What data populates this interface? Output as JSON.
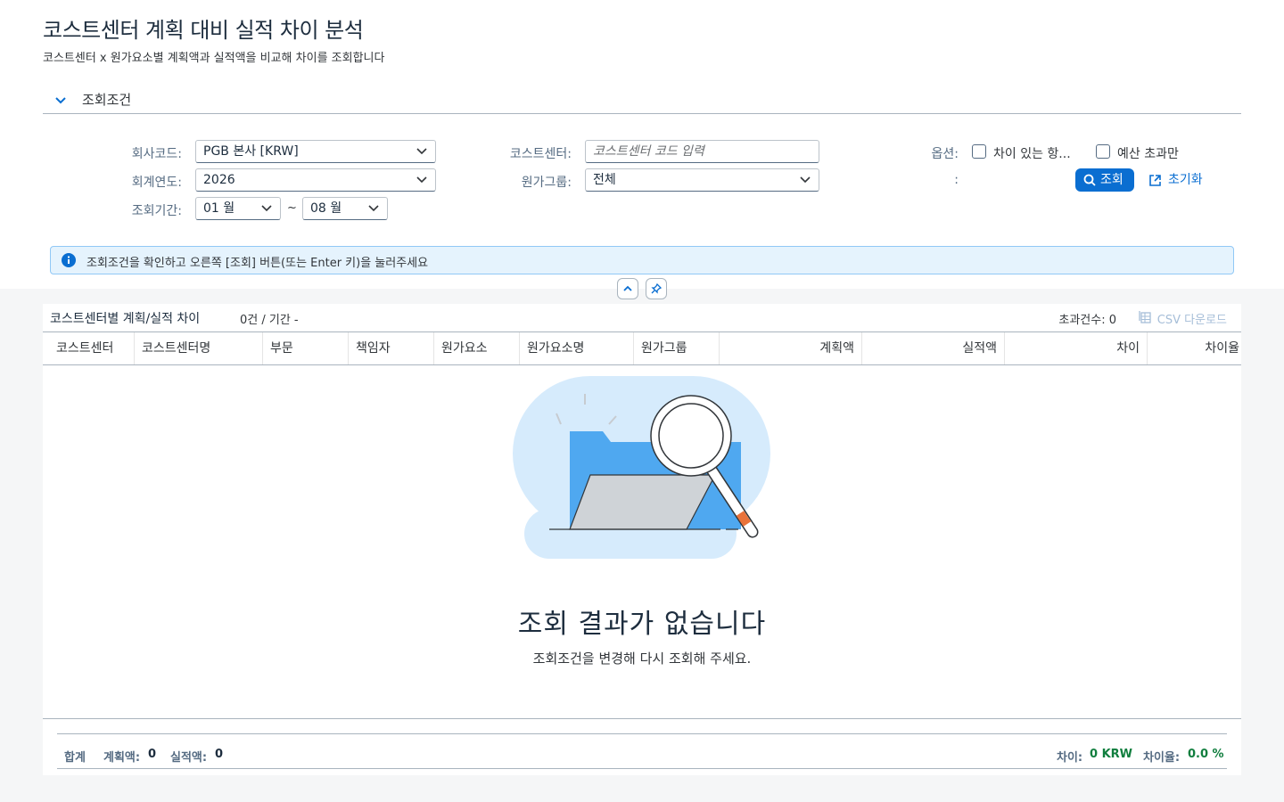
{
  "page": {
    "title": "코스트센터 계획 대비 실적 차이 분석",
    "subtitle": "코스트센터 x 원가요소별 계획액과 실적액을 비교해 차이를 조회합니다"
  },
  "filters": {
    "section_title": "조회조건",
    "company_label": "회사코드:",
    "company_value": "PGB 본사 [KRW]",
    "year_label": "회계연도:",
    "year_value": "2026",
    "period_label": "조회기간:",
    "period_from": "01 월",
    "period_sep": "~",
    "period_to": "08 월",
    "costcenter_label": "코스트센터:",
    "costcenter_placeholder": "코스트센터 코드 입력",
    "costgroup_label": "원가그룹:",
    "costgroup_value": "전체",
    "options_label": "옵션:",
    "option_diff_only": "차이 있는 항...",
    "option_over_budget": "예산 초과만",
    "colon_label": ":",
    "search_button": "조회",
    "reset_button": "초기화"
  },
  "info_message": "조회조건을 확인하고 오른쪽 [조회] 버튼(또는 Enter 키)을 눌러주세요",
  "table": {
    "title": "코스트센터별 계획/실적 차이",
    "meta": "0건 / 기간 -",
    "exceed_count": "초과건수: 0",
    "csv_button": "CSV 다운로드",
    "columns": [
      "코스트센터",
      "코스트센터명",
      "부문",
      "책임자",
      "원가요소",
      "원가요소명",
      "원가그룹",
      "계획액",
      "실적액",
      "차이",
      "차이율"
    ]
  },
  "empty_state": {
    "title": "조회 결과가 없습니다",
    "message": "조회조건을 변경해 다시 조회해 주세요."
  },
  "footer": {
    "total_label": "합계",
    "plan_label": "계획액:",
    "plan_value": "0",
    "actual_label": "실적액:",
    "actual_value": "0",
    "diff_label": "차이:",
    "diff_value": "0 KRW",
    "rate_label": "차이율:",
    "rate_value": "0.0 %"
  },
  "colors": {
    "primary": "#0a6ed1",
    "info_bg": "#e5f3fd",
    "positive": "#107e3e"
  }
}
